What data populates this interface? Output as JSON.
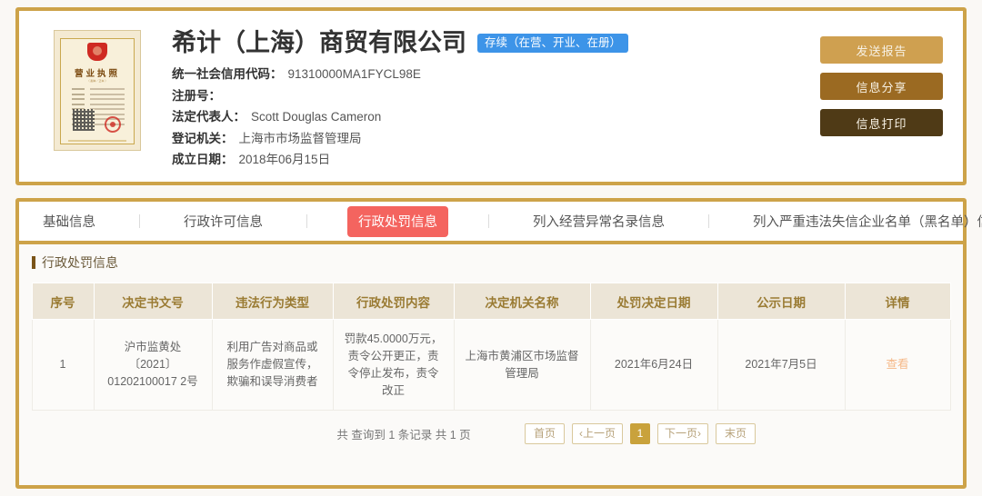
{
  "company": {
    "name": "希计（上海）商贸有限公司",
    "status_badge": "存续（在营、开业、在册）",
    "license_thumb": {
      "title": "营业执照",
      "subtitle": "（ 副本／正本 ）"
    },
    "fields": [
      {
        "label": "统一社会信用代码：",
        "value": "91310000MA1FYCL98E"
      },
      {
        "label": "注册号：",
        "value": ""
      },
      {
        "label": "法定代表人：",
        "value": "Scott Douglas Cameron"
      },
      {
        "label": "登记机关：",
        "value": "上海市市场监督管理局"
      },
      {
        "label": "成立日期：",
        "value": "2018年06月15日"
      }
    ],
    "actions": [
      {
        "label": "发送报告",
        "color": "#cfa050"
      },
      {
        "label": "信息分享",
        "color": "#9b6a22"
      },
      {
        "label": "信息打印",
        "color": "#4f3a16"
      }
    ]
  },
  "tabs": [
    {
      "label": "基础信息",
      "active": false
    },
    {
      "label": "行政许可信息",
      "active": false
    },
    {
      "label": "行政处罚信息",
      "active": true
    },
    {
      "label": "列入经营异常名录信息",
      "active": false
    },
    {
      "label": "列入严重违法失信企业名单（黑名单）信息",
      "active": false
    }
  ],
  "section": {
    "title": "行政处罚信息"
  },
  "table": {
    "columns": [
      "序号",
      "决定书文号",
      "违法行为类型",
      "行政处罚内容",
      "决定机关名称",
      "处罚决定日期",
      "公示日期",
      "详情"
    ],
    "rows": [
      {
        "index": "1",
        "doc_no": "沪市监黄处〔2021〕01202100017 2号",
        "violation_type": "利用广告对商品或服务作虚假宣传，欺骗和误导消费者",
        "penalty_content": "罚款45.0000万元，责令公开更正，责令停止发布，责令改正",
        "authority": "上海市黄浦区市场监督管理局",
        "decision_date": "2021年6月24日",
        "publish_date": "2021年7月5日",
        "detail_link": "查看"
      }
    ]
  },
  "pagination": {
    "summary": "共 查询到 1 条记录 共 1 页",
    "first": "首页",
    "prev": "‹上一页",
    "current": "1",
    "next": "下一页›",
    "last": "末页"
  },
  "colors": {
    "border_gold": "#cda349",
    "accent_red": "#f4645f",
    "badge_blue": "#3d94e8",
    "header_beige": "#ece5d7",
    "header_text": "#9a7b33",
    "link_orange": "#f5b888",
    "page_active": "#c9a23c"
  }
}
